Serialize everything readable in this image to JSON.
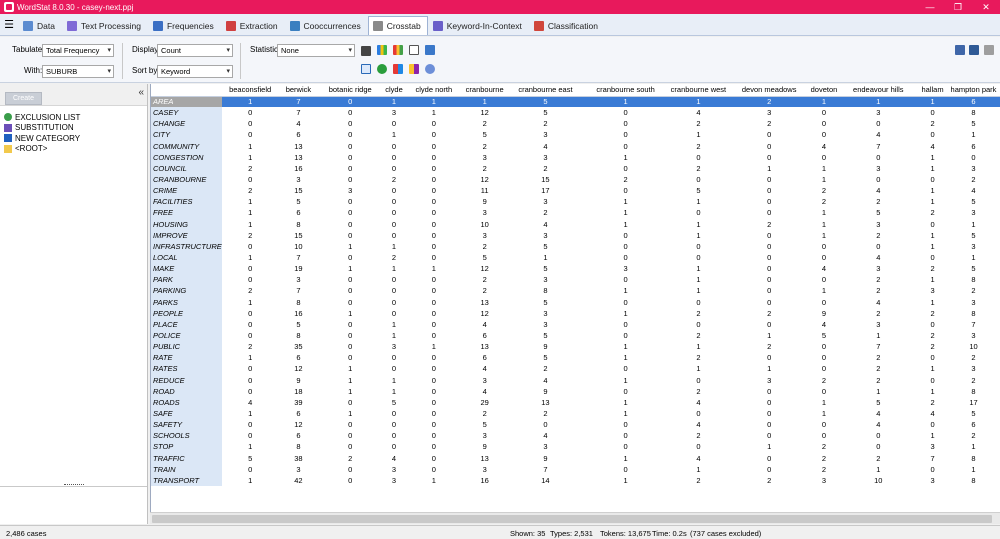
{
  "titlebar": {
    "title": "WordStat 8.0.30 - casey-next.ppj",
    "minimize": "—",
    "maximize": "❐",
    "close": "✕"
  },
  "tabs": [
    {
      "label": "Data",
      "color": "#5b8bd0"
    },
    {
      "label": "Text Processing",
      "color": "#7f6ad6"
    },
    {
      "label": "Frequencies",
      "color": "#3b6fc4"
    },
    {
      "label": "Extraction",
      "color": "#d04040"
    },
    {
      "label": "Cooccurrences",
      "color": "#3a7fc0"
    },
    {
      "label": "Crosstab",
      "color": "#8a8a8a"
    },
    {
      "label": "Keyword-In-Context",
      "color": "#6a5fc9"
    },
    {
      "label": "Classification",
      "color": "#d0463b"
    }
  ],
  "active_tab": "Crosstab",
  "toolbar": {
    "tabulate_label": "Tabulate:",
    "tabulate_value": "Total Frequency",
    "with_label": "With:",
    "with_value": "SUBURB",
    "display_label": "Display:",
    "display_value": "Count",
    "sortby_label": "Sort by:",
    "sortby_value": "Keyword",
    "statistic_label": "Statistic:",
    "statistic_value": "None"
  },
  "left_panel": {
    "create_button": "Create",
    "collapse": "«",
    "tree": [
      {
        "label": "EXCLUSION LIST",
        "icon": "exclusion-icon"
      },
      {
        "label": "SUBSTITUTION",
        "icon": "substitution-icon"
      },
      {
        "label": "NEW CATEGORY",
        "icon": "plus-icon"
      },
      {
        "label": "<ROOT>",
        "icon": "folder-icon"
      }
    ]
  },
  "table": {
    "columns": [
      "beaconsfield",
      "berwick",
      "botanic ridge",
      "clyde",
      "clyde north",
      "cranbourne",
      "cranbourne east",
      "cranbourne south",
      "cranbourne west",
      "devon meadows",
      "doveton",
      "endeavour hills",
      "hallam",
      "hampton park"
    ],
    "rows": [
      {
        "k": "AREA",
        "v": [
          "1",
          "7",
          "0",
          "1",
          "1",
          "1",
          "5",
          "1",
          "1",
          "2",
          "1",
          "1",
          "1",
          "6"
        ]
      },
      {
        "k": "CASEY",
        "v": [
          "0",
          "7",
          "0",
          "3",
          "1",
          "12",
          "5",
          "0",
          "4",
          "3",
          "0",
          "3",
          "0",
          "8"
        ]
      },
      {
        "k": "CHANGE",
        "v": [
          "0",
          "4",
          "0",
          "0",
          "0",
          "2",
          "2",
          "0",
          "2",
          "2",
          "0",
          "0",
          "2",
          "5"
        ]
      },
      {
        "k": "CITY",
        "v": [
          "0",
          "6",
          "0",
          "1",
          "0",
          "5",
          "3",
          "0",
          "1",
          "0",
          "0",
          "4",
          "0",
          "1"
        ]
      },
      {
        "k": "COMMUNITY",
        "v": [
          "1",
          "13",
          "0",
          "0",
          "0",
          "2",
          "4",
          "0",
          "2",
          "0",
          "4",
          "7",
          "4",
          "6"
        ]
      },
      {
        "k": "CONGESTION",
        "v": [
          "1",
          "13",
          "0",
          "0",
          "0",
          "3",
          "3",
          "1",
          "0",
          "0",
          "0",
          "0",
          "1",
          "0"
        ]
      },
      {
        "k": "COUNCIL",
        "v": [
          "2",
          "16",
          "0",
          "0",
          "0",
          "2",
          "2",
          "0",
          "2",
          "1",
          "1",
          "3",
          "1",
          "3"
        ]
      },
      {
        "k": "CRANBOURNE",
        "v": [
          "0",
          "3",
          "0",
          "2",
          "0",
          "12",
          "15",
          "2",
          "0",
          "0",
          "1",
          "0",
          "0",
          "2"
        ]
      },
      {
        "k": "CRIME",
        "v": [
          "2",
          "15",
          "3",
          "0",
          "0",
          "11",
          "17",
          "0",
          "5",
          "0",
          "2",
          "4",
          "1",
          "4"
        ]
      },
      {
        "k": "FACILITIES",
        "v": [
          "1",
          "5",
          "0",
          "0",
          "0",
          "9",
          "3",
          "1",
          "1",
          "0",
          "2",
          "2",
          "1",
          "5"
        ]
      },
      {
        "k": "FREE",
        "v": [
          "1",
          "6",
          "0",
          "0",
          "0",
          "3",
          "2",
          "1",
          "0",
          "0",
          "1",
          "5",
          "2",
          "3"
        ]
      },
      {
        "k": "HOUSING",
        "v": [
          "1",
          "8",
          "0",
          "0",
          "0",
          "10",
          "4",
          "1",
          "1",
          "2",
          "1",
          "3",
          "0",
          "1"
        ]
      },
      {
        "k": "IMPROVE",
        "v": [
          "2",
          "15",
          "0",
          "0",
          "0",
          "3",
          "3",
          "0",
          "1",
          "0",
          "1",
          "2",
          "1",
          "5"
        ]
      },
      {
        "k": "INFRASTRUCTURE",
        "v": [
          "0",
          "10",
          "1",
          "1",
          "0",
          "2",
          "5",
          "0",
          "0",
          "0",
          "0",
          "0",
          "1",
          "3"
        ]
      },
      {
        "k": "LOCAL",
        "v": [
          "1",
          "7",
          "0",
          "2",
          "0",
          "5",
          "1",
          "0",
          "0",
          "0",
          "0",
          "4",
          "0",
          "1"
        ]
      },
      {
        "k": "MAKE",
        "v": [
          "0",
          "19",
          "1",
          "1",
          "1",
          "12",
          "5",
          "3",
          "1",
          "0",
          "4",
          "3",
          "2",
          "5"
        ]
      },
      {
        "k": "PARK",
        "v": [
          "0",
          "3",
          "0",
          "0",
          "0",
          "2",
          "3",
          "0",
          "1",
          "0",
          "0",
          "2",
          "1",
          "8"
        ]
      },
      {
        "k": "PARKING",
        "v": [
          "2",
          "7",
          "0",
          "0",
          "0",
          "2",
          "8",
          "1",
          "1",
          "0",
          "1",
          "2",
          "3",
          "2"
        ]
      },
      {
        "k": "PARKS",
        "v": [
          "1",
          "8",
          "0",
          "0",
          "0",
          "13",
          "5",
          "0",
          "0",
          "0",
          "0",
          "4",
          "1",
          "3"
        ]
      },
      {
        "k": "PEOPLE",
        "v": [
          "0",
          "16",
          "1",
          "0",
          "0",
          "12",
          "3",
          "1",
          "2",
          "2",
          "9",
          "2",
          "2",
          "8"
        ]
      },
      {
        "k": "PLACE",
        "v": [
          "0",
          "5",
          "0",
          "1",
          "0",
          "4",
          "3",
          "0",
          "0",
          "0",
          "4",
          "3",
          "0",
          "7"
        ]
      },
      {
        "k": "POLICE",
        "v": [
          "0",
          "8",
          "0",
          "1",
          "0",
          "6",
          "5",
          "0",
          "2",
          "1",
          "5",
          "1",
          "2",
          "3"
        ]
      },
      {
        "k": "PUBLIC",
        "v": [
          "2",
          "35",
          "0",
          "3",
          "1",
          "13",
          "9",
          "1",
          "1",
          "2",
          "0",
          "7",
          "2",
          "10"
        ]
      },
      {
        "k": "RATE",
        "v": [
          "1",
          "6",
          "0",
          "0",
          "0",
          "6",
          "5",
          "1",
          "2",
          "0",
          "0",
          "2",
          "0",
          "2"
        ]
      },
      {
        "k": "RATES",
        "v": [
          "0",
          "12",
          "1",
          "0",
          "0",
          "4",
          "2",
          "0",
          "1",
          "1",
          "0",
          "2",
          "1",
          "3"
        ]
      },
      {
        "k": "REDUCE",
        "v": [
          "0",
          "9",
          "1",
          "1",
          "0",
          "3",
          "4",
          "1",
          "0",
          "3",
          "2",
          "2",
          "0",
          "2"
        ]
      },
      {
        "k": "ROAD",
        "v": [
          "0",
          "18",
          "1",
          "1",
          "0",
          "4",
          "9",
          "0",
          "2",
          "0",
          "0",
          "1",
          "1",
          "8"
        ]
      },
      {
        "k": "ROADS",
        "v": [
          "4",
          "39",
          "0",
          "5",
          "0",
          "29",
          "13",
          "1",
          "4",
          "0",
          "1",
          "5",
          "2",
          "17"
        ]
      },
      {
        "k": "SAFE",
        "v": [
          "1",
          "6",
          "1",
          "0",
          "0",
          "2",
          "2",
          "1",
          "0",
          "0",
          "1",
          "4",
          "4",
          "5"
        ]
      },
      {
        "k": "SAFETY",
        "v": [
          "0",
          "12",
          "0",
          "0",
          "0",
          "5",
          "0",
          "0",
          "4",
          "0",
          "0",
          "4",
          "0",
          "6"
        ]
      },
      {
        "k": "SCHOOLS",
        "v": [
          "0",
          "6",
          "0",
          "0",
          "0",
          "3",
          "4",
          "0",
          "2",
          "0",
          "0",
          "0",
          "1",
          "2"
        ]
      },
      {
        "k": "STOP",
        "v": [
          "1",
          "8",
          "0",
          "0",
          "0",
          "9",
          "3",
          "0",
          "0",
          "1",
          "2",
          "0",
          "3",
          "1"
        ]
      },
      {
        "k": "TRAFFIC",
        "v": [
          "5",
          "38",
          "2",
          "4",
          "0",
          "13",
          "9",
          "1",
          "4",
          "0",
          "2",
          "2",
          "7",
          "8"
        ]
      },
      {
        "k": "TRAIN",
        "v": [
          "0",
          "3",
          "0",
          "3",
          "0",
          "3",
          "7",
          "0",
          "1",
          "0",
          "2",
          "1",
          "0",
          "1"
        ]
      },
      {
        "k": "TRANSPORT",
        "v": [
          "1",
          "42",
          "0",
          "3",
          "1",
          "16",
          "14",
          "1",
          "2",
          "2",
          "3",
          "10",
          "3",
          "8"
        ]
      }
    ]
  },
  "status": {
    "cases": "2,486 cases",
    "shown": "Shown: 35",
    "types": "Types: 2,531",
    "tokens": "Tokens: 13,675",
    "time": "Time: 0.2s",
    "excluded": "(737 cases excluded)"
  }
}
